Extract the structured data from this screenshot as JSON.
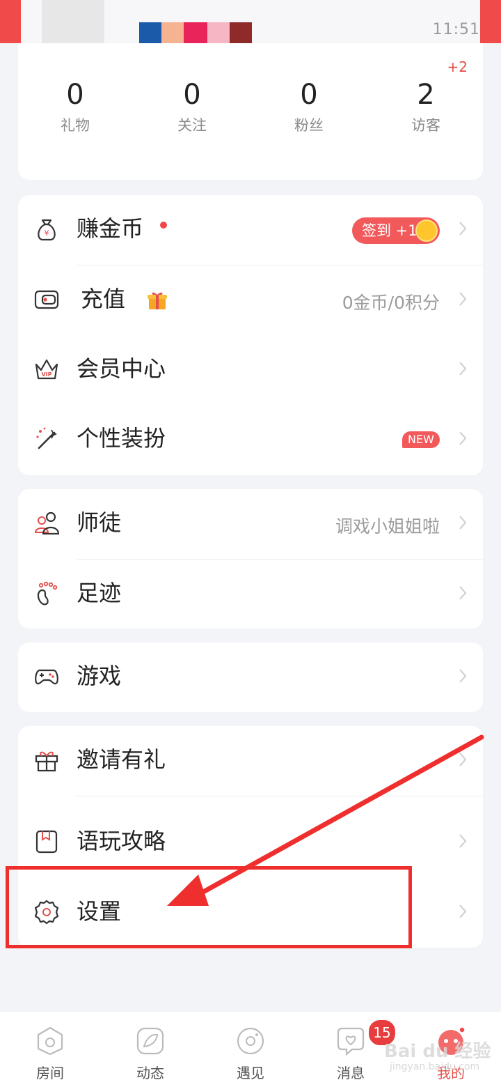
{
  "status_bar": {
    "time": "11:51"
  },
  "stats": [
    {
      "value": "0",
      "label": "礼物"
    },
    {
      "value": "0",
      "label": "关注"
    },
    {
      "value": "0",
      "label": "粉丝"
    },
    {
      "value": "2",
      "label": "访客",
      "badge": "+2"
    }
  ],
  "menu_group_1": {
    "earn": {
      "label": "赚金币",
      "pill": "签到 +1"
    },
    "recharge": {
      "label": "充值",
      "value": "0金币/0积分"
    },
    "vip": {
      "label": "会员中心"
    },
    "dressup": {
      "label": "个性装扮",
      "badge": "NEW"
    }
  },
  "menu_group_2": {
    "mentor": {
      "label": "师徒",
      "value": "调戏小姐姐啦"
    },
    "footprint": {
      "label": "足迹"
    }
  },
  "menu_group_3": {
    "games": {
      "label": "游戏"
    }
  },
  "menu_group_4": {
    "invite": {
      "label": "邀请有礼"
    },
    "guide": {
      "label": "语玩攻略"
    },
    "settings": {
      "label": "设置"
    }
  },
  "bottom_nav": {
    "tabs": [
      {
        "label": "房间",
        "icon": "room-icon"
      },
      {
        "label": "动态",
        "icon": "feed-icon"
      },
      {
        "label": "遇见",
        "icon": "meet-icon"
      },
      {
        "label": "消息",
        "icon": "message-icon"
      },
      {
        "label": "我的",
        "icon": "profile-icon"
      }
    ],
    "message_badge": "15"
  },
  "watermark": {
    "text": "Bai du 经验",
    "sub": "jingyan.baidu.com"
  },
  "colors": {
    "accent": "#e3504b",
    "highlight": "#ef2e2e",
    "background": "#f3f4f7"
  }
}
